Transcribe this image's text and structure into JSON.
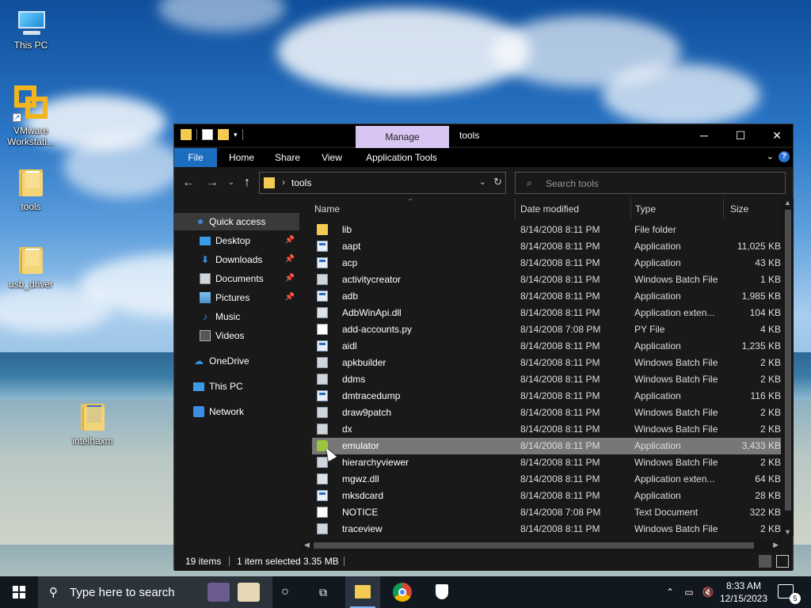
{
  "desktop": {
    "icons": [
      {
        "label": "This PC"
      },
      {
        "label": "VMware Workstati..."
      },
      {
        "label": "tools"
      },
      {
        "label": "usb_driver"
      },
      {
        "label": "intelhaxm"
      }
    ]
  },
  "window": {
    "title": "tools",
    "manage_tab": "Manage",
    "ribbon_tabs": [
      "File",
      "Home",
      "Share",
      "View",
      "Application Tools"
    ],
    "help_label": "?",
    "address": {
      "path": "tools"
    },
    "search": {
      "placeholder": "Search tools"
    },
    "nav": [
      {
        "label": "Quick access",
        "icon": "star-icon"
      },
      {
        "label": "Desktop",
        "icon": "desktop-icon",
        "pinned": true
      },
      {
        "label": "Downloads",
        "icon": "download-icon",
        "pinned": true
      },
      {
        "label": "Documents",
        "icon": "documents-icon",
        "pinned": true
      },
      {
        "label": "Pictures",
        "icon": "pictures-icon",
        "pinned": true
      },
      {
        "label": "Music",
        "icon": "music-icon"
      },
      {
        "label": "Videos",
        "icon": "videos-icon"
      },
      {
        "label": "OneDrive",
        "icon": "cloud-icon"
      },
      {
        "label": "This PC",
        "icon": "computer-icon"
      },
      {
        "label": "Network",
        "icon": "network-icon"
      }
    ],
    "columns": {
      "name": "Name",
      "date": "Date modified",
      "type": "Type",
      "size": "Size"
    },
    "files": [
      {
        "name": "lib",
        "date": "8/14/2008 8:11 PM",
        "type": "File folder",
        "size": "",
        "icon": "folder"
      },
      {
        "name": "aapt",
        "date": "8/14/2008 8:11 PM",
        "type": "Application",
        "size": "11,025 KB",
        "icon": "app"
      },
      {
        "name": "acp",
        "date": "8/14/2008 8:11 PM",
        "type": "Application",
        "size": "43 KB",
        "icon": "app"
      },
      {
        "name": "activitycreator",
        "date": "8/14/2008 8:11 PM",
        "type": "Windows Batch File",
        "size": "1 KB",
        "icon": "bat"
      },
      {
        "name": "adb",
        "date": "8/14/2008 8:11 PM",
        "type": "Application",
        "size": "1,985 KB",
        "icon": "app"
      },
      {
        "name": "AdbWinApi.dll",
        "date": "8/14/2008 8:11 PM",
        "type": "Application exten...",
        "size": "104 KB",
        "icon": "dll"
      },
      {
        "name": "add-accounts.py",
        "date": "8/14/2008 7:08 PM",
        "type": "PY File",
        "size": "4 KB",
        "icon": "doc"
      },
      {
        "name": "aidl",
        "date": "8/14/2008 8:11 PM",
        "type": "Application",
        "size": "1,235 KB",
        "icon": "app"
      },
      {
        "name": "apkbuilder",
        "date": "8/14/2008 8:11 PM",
        "type": "Windows Batch File",
        "size": "2 KB",
        "icon": "bat"
      },
      {
        "name": "ddms",
        "date": "8/14/2008 8:11 PM",
        "type": "Windows Batch File",
        "size": "2 KB",
        "icon": "bat"
      },
      {
        "name": "dmtracedump",
        "date": "8/14/2008 8:11 PM",
        "type": "Application",
        "size": "116 KB",
        "icon": "app"
      },
      {
        "name": "draw9patch",
        "date": "8/14/2008 8:11 PM",
        "type": "Windows Batch File",
        "size": "2 KB",
        "icon": "bat"
      },
      {
        "name": "dx",
        "date": "8/14/2008 8:11 PM",
        "type": "Windows Batch File",
        "size": "2 KB",
        "icon": "bat"
      },
      {
        "name": "emulator",
        "date": "8/14/2008 8:11 PM",
        "type": "Application",
        "size": "3,433 KB",
        "icon": "android",
        "selected": true
      },
      {
        "name": "hierarchyviewer",
        "date": "8/14/2008 8:11 PM",
        "type": "Windows Batch File",
        "size": "2 KB",
        "icon": "bat"
      },
      {
        "name": "mgwz.dll",
        "date": "8/14/2008 8:11 PM",
        "type": "Application exten...",
        "size": "64 KB",
        "icon": "dll"
      },
      {
        "name": "mksdcard",
        "date": "8/14/2008 8:11 PM",
        "type": "Application",
        "size": "28 KB",
        "icon": "app"
      },
      {
        "name": "NOTICE",
        "date": "8/14/2008 7:08 PM",
        "type": "Text Document",
        "size": "322 KB",
        "icon": "doc"
      },
      {
        "name": "traceview",
        "date": "8/14/2008 8:11 PM",
        "type": "Windows Batch File",
        "size": "2 KB",
        "icon": "bat"
      }
    ],
    "status": {
      "count": "19 items",
      "selection": "1 item selected",
      "size": "3.35 MB"
    }
  },
  "taskbar": {
    "search_text": "Type here to search",
    "time": "8:33 AM",
    "date": "12/15/2023",
    "notifications": "5"
  },
  "colors": {
    "accent": "#1b6dbf",
    "manage_tab": "#d8c5f2",
    "window_bg": "#191919"
  }
}
